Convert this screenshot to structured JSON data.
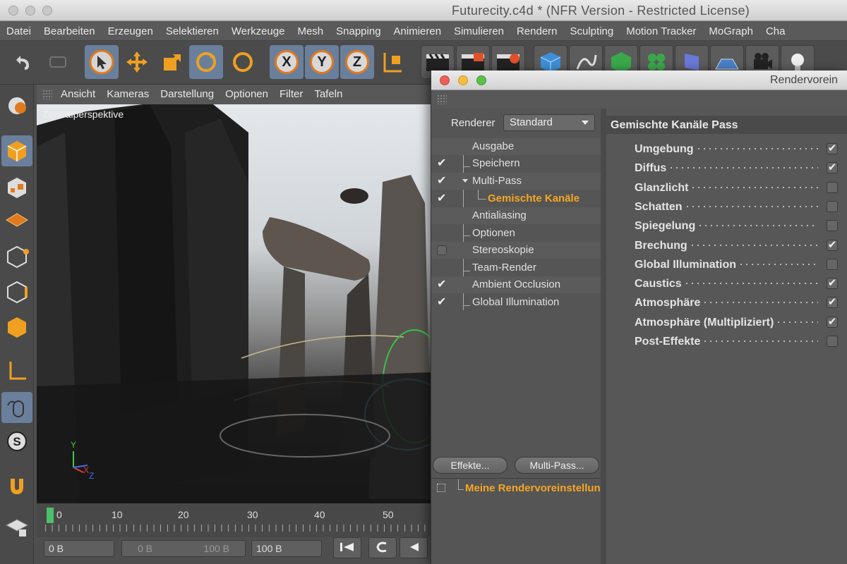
{
  "window": {
    "title": "Futurecity.c4d * (NFR Version - Restricted License)"
  },
  "menubar": [
    "Datei",
    "Bearbeiten",
    "Erzeugen",
    "Selektieren",
    "Werkzeuge",
    "Mesh",
    "Snapping",
    "Animieren",
    "Simulieren",
    "Rendern",
    "Sculpting",
    "Motion Tracker",
    "MoGraph",
    "Cha"
  ],
  "toolbar": {
    "axis_x": "X",
    "axis_y": "Y",
    "axis_z": "Z"
  },
  "viewport": {
    "menu": [
      "Ansicht",
      "Kameras",
      "Darstellung",
      "Optionen",
      "Filter",
      "Tafeln"
    ],
    "label": "Zentralperspektive",
    "axes": {
      "y": "Y",
      "x": "X",
      "z": "Z"
    }
  },
  "timeline": {
    "marks": [
      "0",
      "10",
      "20",
      "30",
      "40",
      "50"
    ],
    "field_start": "0 B",
    "field_range_start": "0 B",
    "field_range_end": "100 B",
    "field_end": "100 B"
  },
  "render_window": {
    "title": "Rendervorein",
    "renderer_label": "Renderer",
    "renderer_value": "Standard",
    "tree": [
      {
        "label": "Ausgabe",
        "check": "none"
      },
      {
        "label": "Speichern",
        "check": "checked"
      },
      {
        "label": "Multi-Pass",
        "check": "checked"
      },
      {
        "label": "Gemischte Kanäle",
        "check": "checked"
      },
      {
        "label": "Antialiasing",
        "check": "none"
      },
      {
        "label": "Optionen",
        "check": "none"
      },
      {
        "label": "Stereoskopie",
        "check": "empty"
      },
      {
        "label": "Team-Render",
        "check": "none"
      },
      {
        "label": "Ambient Occlusion",
        "check": "checked"
      },
      {
        "label": "Global Illumination",
        "check": "checked"
      }
    ],
    "buttons": {
      "effects": "Effekte...",
      "multipass": "Multi-Pass..."
    },
    "preset": "Meine Rendervoreinstellun",
    "pass_header": "Gemischte Kanäle Pass",
    "channels": [
      {
        "label": "Umgebung",
        "checked": true
      },
      {
        "label": "Diffus",
        "checked": true
      },
      {
        "label": "Glanzlicht",
        "checked": false
      },
      {
        "label": "Schatten",
        "checked": false
      },
      {
        "label": "Spiegelung",
        "checked": false
      },
      {
        "label": "Brechung",
        "checked": true
      },
      {
        "label": "Global Illumination",
        "checked": false
      },
      {
        "label": "Caustics",
        "checked": true
      },
      {
        "label": "Atmosphäre",
        "checked": true
      },
      {
        "label": "Atmosphäre (Multipliziert)",
        "checked": true
      },
      {
        "label": "Post-Effekte",
        "checked": false
      }
    ]
  },
  "colors": {
    "accent_orange": "#f5a623",
    "selection_blue": "#6a7f9c",
    "timeline_green": "#4cc06a"
  }
}
